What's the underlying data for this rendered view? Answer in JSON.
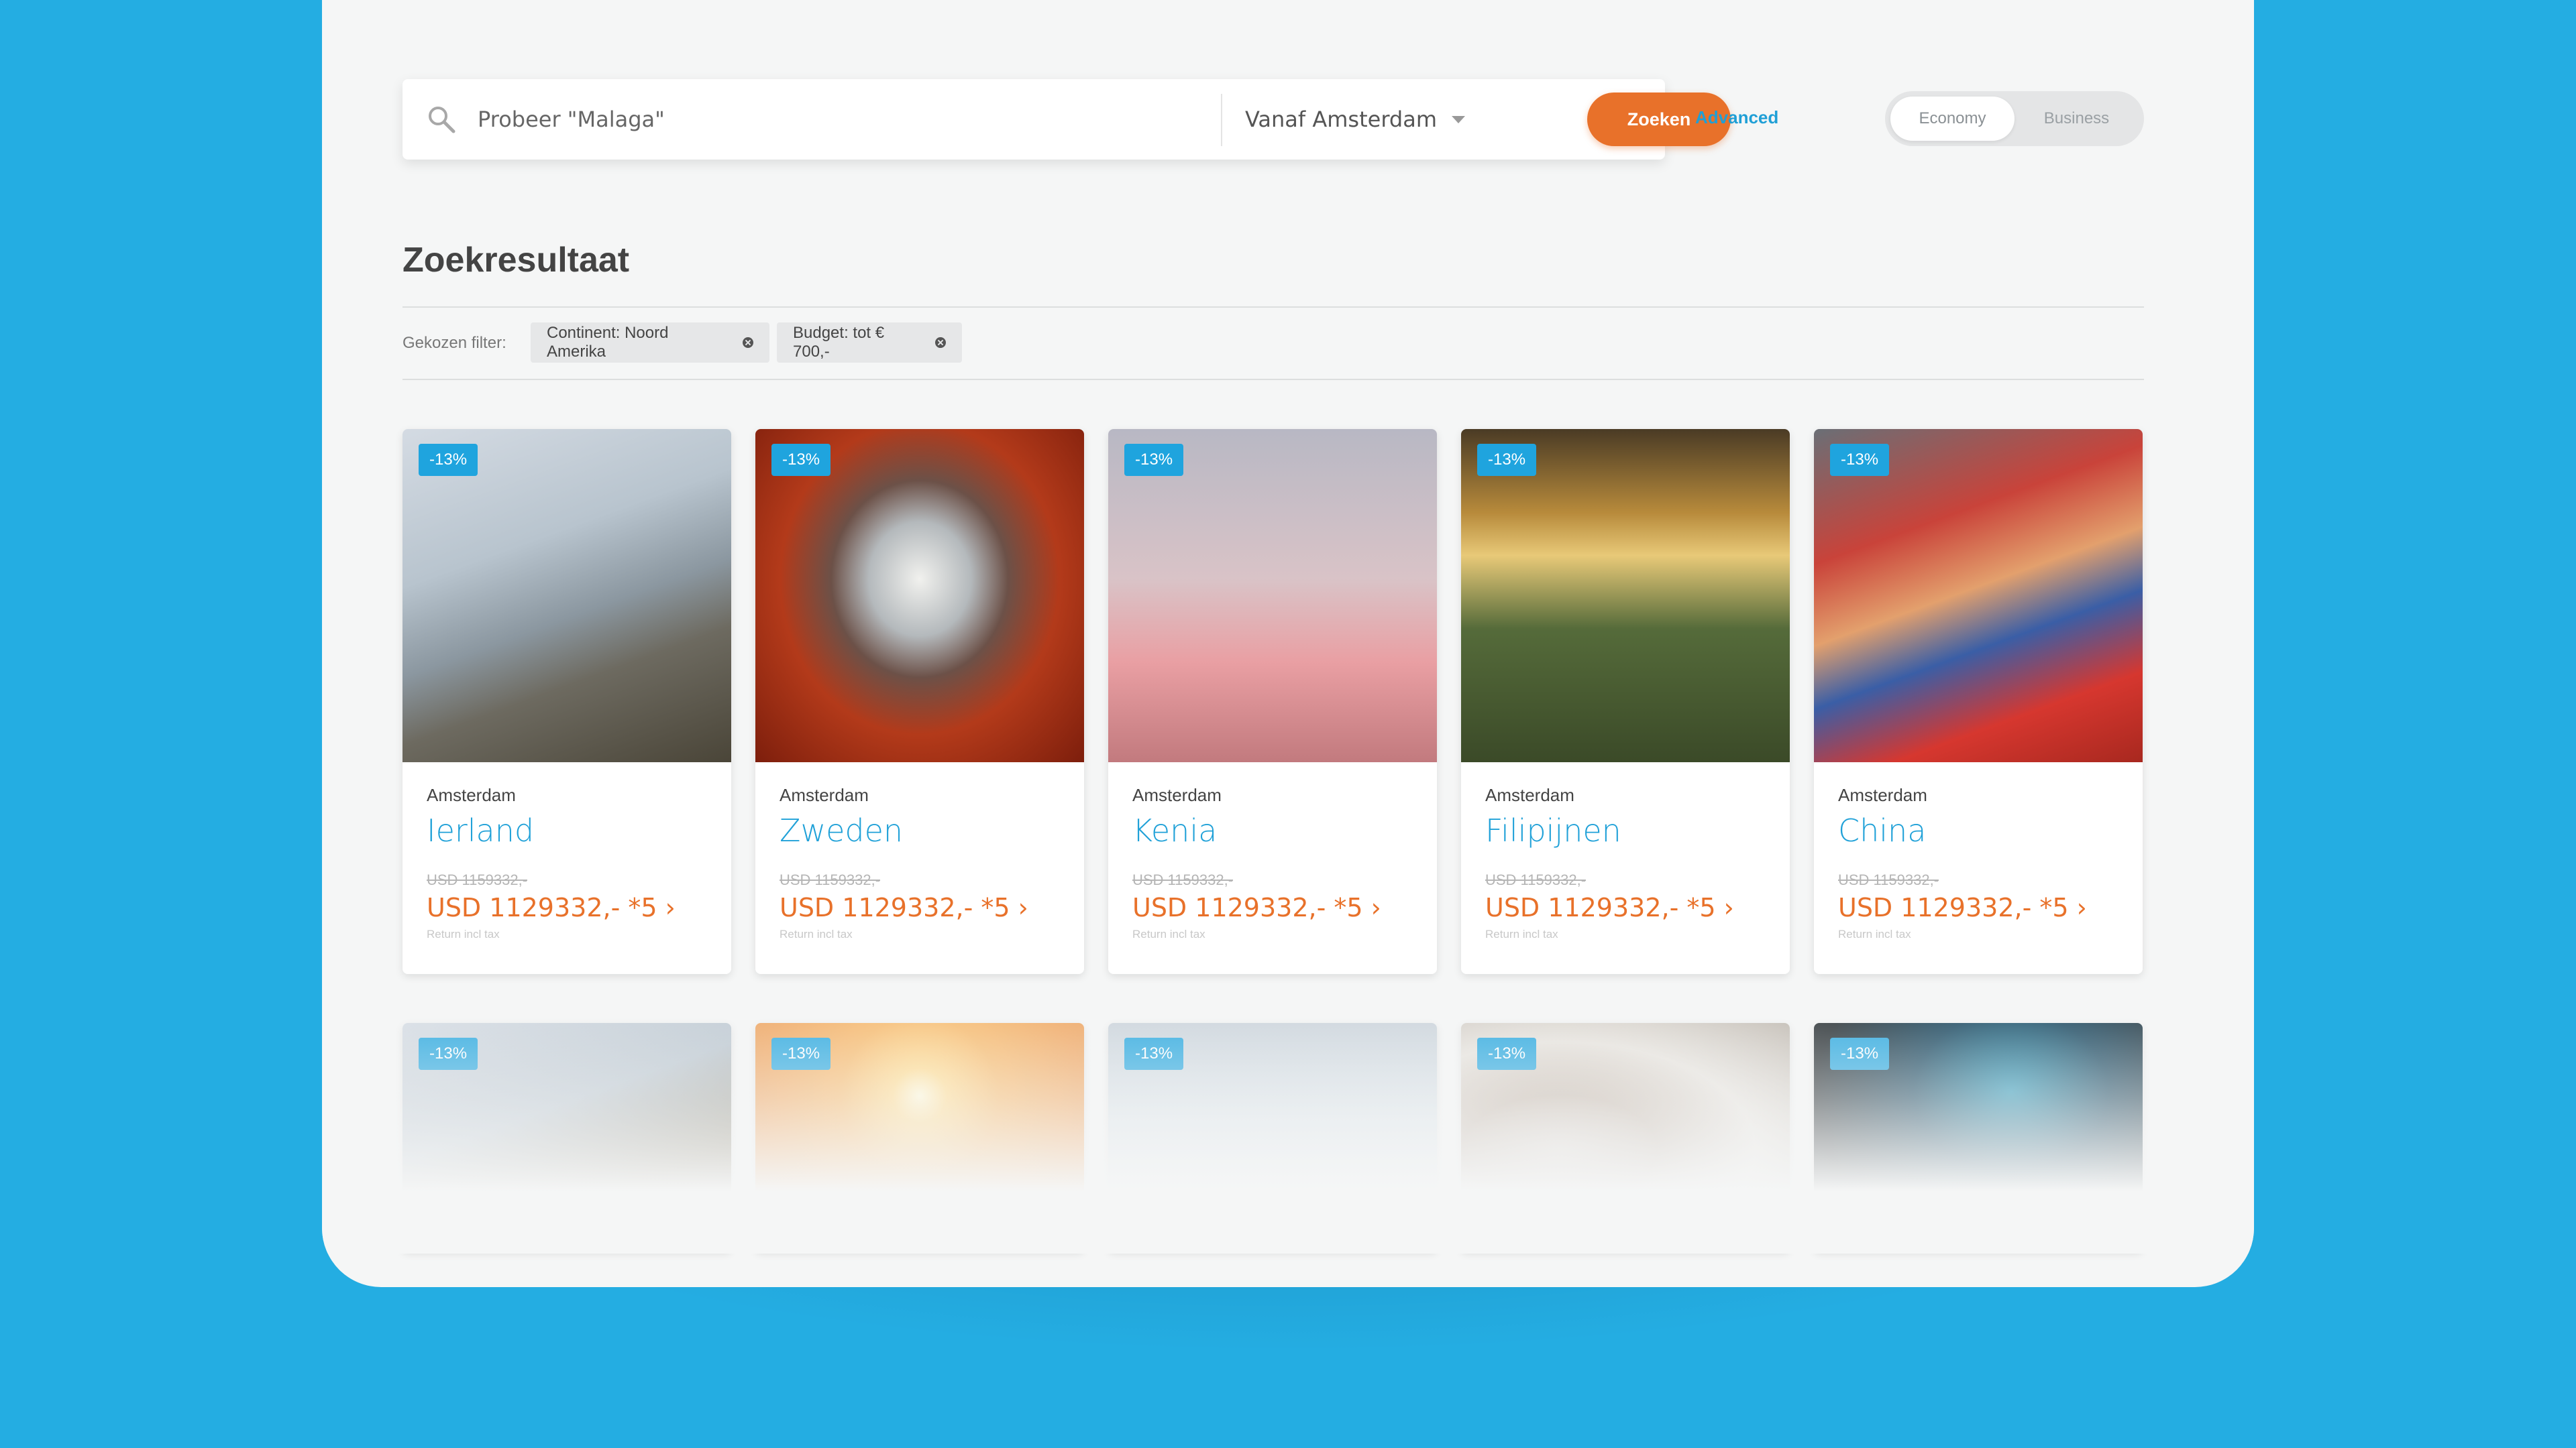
{
  "search": {
    "placeholder": "Probeer \"Malaga\"",
    "from_label": "Vanaf Amsterdam",
    "button_label": "Zoeken",
    "advanced_label": "Advanced"
  },
  "travel_class": {
    "options": [
      "Economy",
      "Business"
    ],
    "selected": "Economy"
  },
  "results": {
    "title": "Zoekresultaat",
    "filter_label": "Gekozen filter:",
    "filters": [
      "Continent: Noord Amerika",
      "Budget: tot € 700,-"
    ]
  },
  "cards": [
    {
      "badge": "-13%",
      "origin": "Amsterdam",
      "destination": "Ierland",
      "old_price": "USD 1159332,-",
      "price": "USD 1129332,- *5 ›",
      "note": "Return incl tax",
      "image": "cliffs-sea"
    },
    {
      "badge": "-13%",
      "origin": "Amsterdam",
      "destination": "Zweden",
      "old_price": "USD 1159332,-",
      "price": "USD 1129332,- *5 ›",
      "note": "Return incl tax",
      "image": "metro-escalator"
    },
    {
      "badge": "-13%",
      "origin": "Amsterdam",
      "destination": "Kenia",
      "old_price": "USD 1159332,-",
      "price": "USD 1129332,- *5 ›",
      "note": "Return incl tax",
      "image": "flamingos"
    },
    {
      "badge": "-13%",
      "origin": "Amsterdam",
      "destination": "Filipijnen",
      "old_price": "USD 1159332,-",
      "price": "USD 1129332,- *5 ›",
      "note": "Return incl tax",
      "image": "island-sunset"
    },
    {
      "badge": "-13%",
      "origin": "Amsterdam",
      "destination": "China",
      "old_price": "USD 1159332,-",
      "price": "USD 1129332,- *5 ›",
      "note": "Return incl tax",
      "image": "rainbow-mountains"
    }
  ],
  "cards_row2": [
    {
      "badge": "-13%",
      "image": "cliffs-sea"
    },
    {
      "badge": "-13%",
      "image": "sunrise-balloons"
    },
    {
      "badge": "-13%",
      "image": "ice-climber"
    },
    {
      "badge": "-13%",
      "image": "snow-monkeys"
    },
    {
      "badge": "-13%",
      "image": "glowworm-cave"
    }
  ],
  "colors": {
    "background": "#24ade2",
    "accent_orange": "#e8712a",
    "accent_blue": "#20a1d8"
  }
}
